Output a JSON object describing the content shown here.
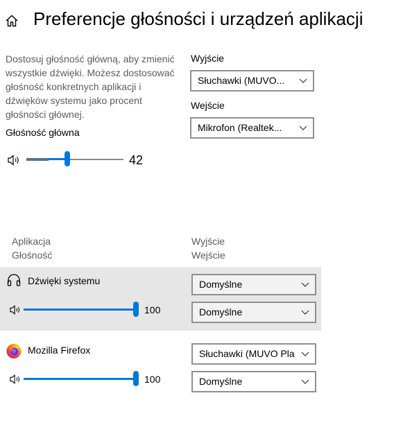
{
  "header": {
    "title": "Preferencje głośności i urządzeń aplikacji",
    "home_icon": "home-icon"
  },
  "master": {
    "description": "Dostosuj głośność główną, aby zmienić wszystkie dźwięki. Możesz dostosować głośność konkretnych aplikacji i dźwięków systemu jako procent głośności głównej.",
    "label": "Głośność główna",
    "value": "42",
    "level": 0.42
  },
  "devices": {
    "output_label": "Wyjście",
    "output_value": "Słuchawki (MUVO...",
    "input_label": "Wejście",
    "input_value": "Mikrofon (Realtek..."
  },
  "columns": {
    "app_header": "Aplikacja",
    "volume_header": "Głośność",
    "output_header": "Wyjście",
    "input_header": "Wejście"
  },
  "apps": [
    {
      "name": "Dźwięki systemu",
      "icon": "headphones-icon",
      "volume": "100",
      "level": 1.0,
      "output": "Domyślne",
      "input": "Domyślne"
    },
    {
      "name": "Mozilla Firefox",
      "icon": "firefox-icon",
      "volume": "100",
      "level": 1.0,
      "output": "Słuchawki (MUVO Pla",
      "input": "Domyślne"
    }
  ],
  "colors": {
    "accent": "#0078d7",
    "selected_row": "#e6e6e6",
    "text_secondary": "#5c5c5c"
  }
}
